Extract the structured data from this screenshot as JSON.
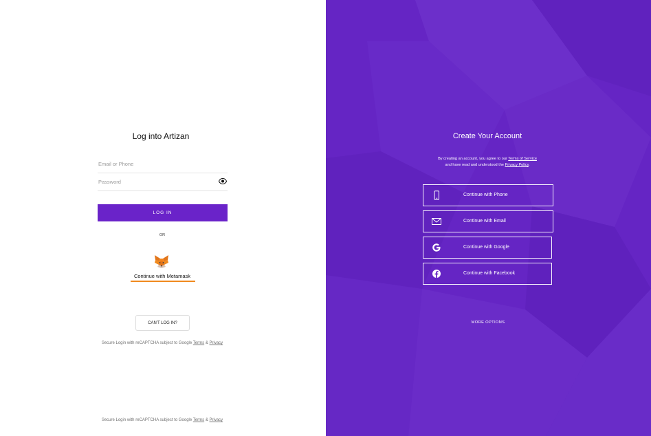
{
  "login": {
    "title": "Log into Artizan",
    "email_placeholder": "Email or Phone",
    "password_placeholder": "Password",
    "login_button": "LOG IN",
    "or_text": "OR",
    "metamask_label": "Continue with Metamask",
    "cant_login_button": "CAN'T LOG IN?",
    "recaptcha_prefix": "Secure Login with reCAPTCHA subject to Google",
    "recaptcha_terms": "Terms",
    "recaptcha_and": "&",
    "recaptcha_privacy": "Privacy"
  },
  "signup": {
    "title": "Create Your Account",
    "agree_line1_prefix": "By creating an account, you agree to our",
    "terms_link": "Terms of Service",
    "agree_line2_prefix": "and have read and understood the",
    "privacy_link": "Privacy Policy",
    "agree_period": ".",
    "options": [
      {
        "label": "Continue with Phone",
        "icon": "phone-icon"
      },
      {
        "label": "Continue with Email",
        "icon": "envelope-icon"
      },
      {
        "label": "Continue with Google",
        "icon": "google-icon"
      },
      {
        "label": "Continue with Facebook",
        "icon": "facebook-icon"
      }
    ],
    "more_options": "MORE OPTIONS"
  },
  "colors": {
    "brand_purple": "#6a23c9",
    "panel_purple": "#6525c4",
    "metamask_orange": "#f08a1e"
  }
}
